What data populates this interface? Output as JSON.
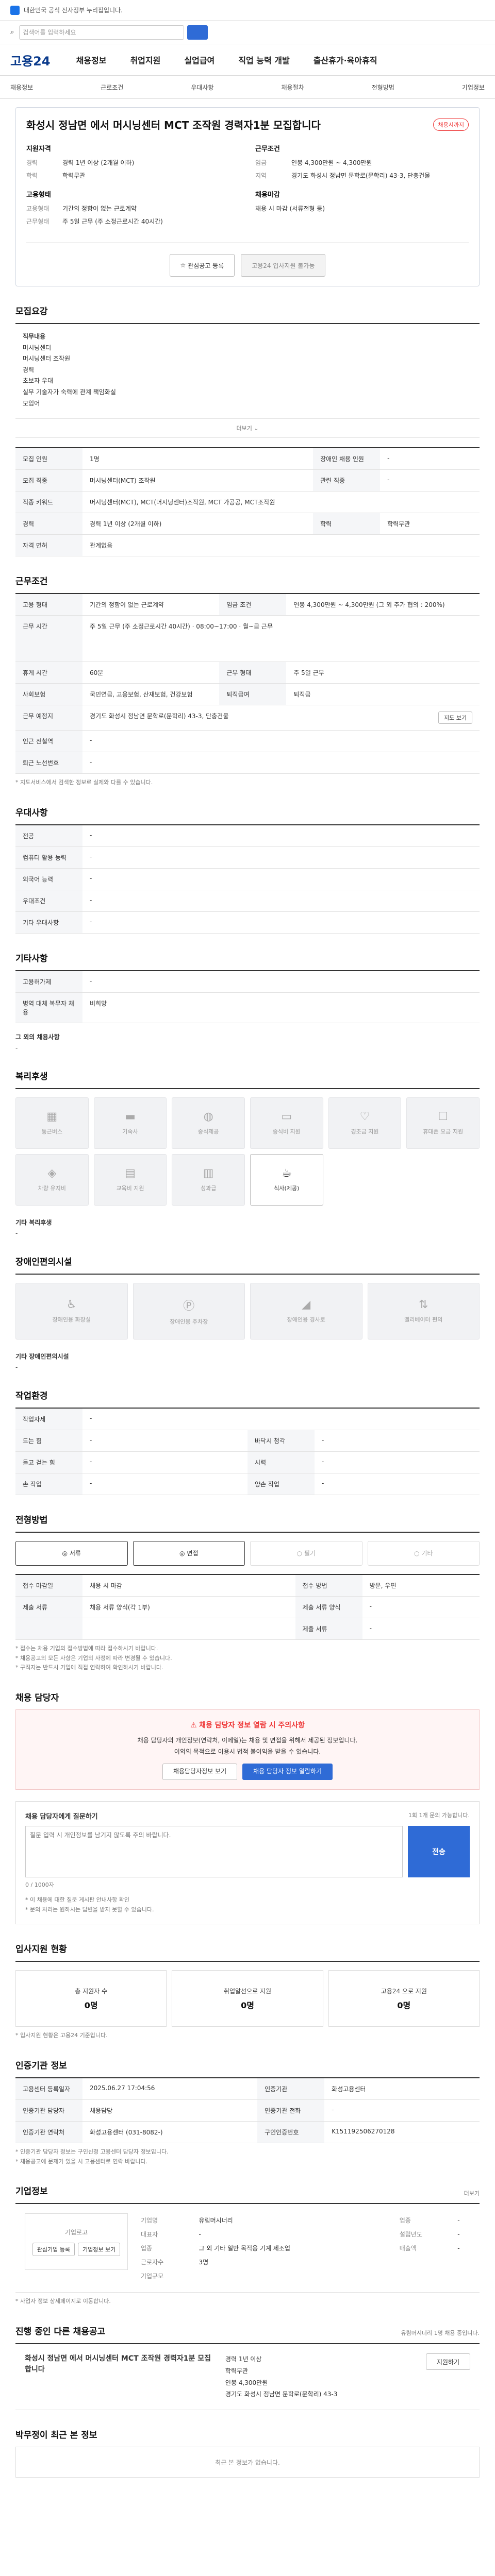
{
  "topbar": {
    "text": "대한민국 공식 전자정부 누리집입니다."
  },
  "search": {
    "placeholder": "검색어를 입력하세요"
  },
  "logo": "고용24",
  "gnb": [
    "채용정보",
    "취업지원",
    "실업급여",
    "직업 능력 개발",
    "출산휴가·육아휴직"
  ],
  "subnav": {
    "left": [
      "채용정보",
      "근로조건",
      "우대사항",
      "채용절차",
      "전형방법"
    ],
    "right": "기업정보"
  },
  "job": {
    "title": "화성시 정남면 에서 머시닝센터 MCT 조작원 경력자1분 모집합니다",
    "badge": "채용시까지",
    "left_h": "지원자격",
    "left": [
      {
        "k": "경력",
        "v": "경력 1년 이상 (2개월 이하)"
      },
      {
        "k": "학력",
        "v": "학력무관"
      }
    ],
    "left2_h": "고용형태",
    "left2": [
      {
        "k": "고용형태",
        "v": "기간의 정함이 없는 근로계약"
      },
      {
        "k": "근무형태",
        "v": "주 5일 근무 (주 소정근로시간 40시간)"
      }
    ],
    "right_h": "근무조건",
    "right": [
      {
        "k": "임금",
        "v": "연봉 4,300만원 ~ 4,300만원"
      },
      {
        "k": "지역",
        "v": "경기도 화성시 정남면 문학로(문학리) 43-3, 단충건물"
      }
    ],
    "right2_h": "채용마감",
    "right2": [
      {
        "k": "",
        "v": "채용 시 마감 (서류전형 등)"
      }
    ],
    "btn1": "관심공고 등록",
    "btn2": "고용24 입사지원 불가능"
  },
  "recruit": {
    "title": "모집요강",
    "desc_lines": [
      "직무내용",
      "머시닝센터",
      "머시닝센터 조작원",
      "경력",
      "초보자 우대",
      "실무 기술자가 숙력에 관계 책임화실",
      "모임어"
    ],
    "more": "더보기",
    "rows": [
      {
        "k": "모집 인원",
        "v": "1명",
        "k2": "장애인 채용 인원",
        "v2": "-"
      },
      {
        "k": "모집 직종",
        "v": "머시닝센터(MCT) 조작원",
        "k2": "관련 직종",
        "v2": "-"
      },
      {
        "k": "직종 키워드",
        "v": "머시닝센터(MCT), MCT(머시닝센터)조작원, MCT 가공공, MCT조작원",
        "k2": "",
        "v2": ""
      },
      {
        "k": "경력",
        "v": "경력 1년 이상 (2개월 이하)",
        "k2": "학력",
        "v2": "학력무관"
      },
      {
        "k": "자격 면허",
        "v": "관계없음",
        "k2": "",
        "v2": ""
      }
    ]
  },
  "conditions": {
    "title": "근무조건",
    "rows": [
      {
        "k": "고용 형태",
        "v": "기간의 정함이 없는 근로계약",
        "k2": "임금 조건",
        "v2": "연봉 4,300만원 ~ 4,300만원 (그 외 추가 협의 : 200%)"
      },
      {
        "k": "근무 시간",
        "v": "주 5일 근무 (주 소정근로시간 40시간) · 08:00~17:00 · 월~금 근무",
        "k2": "",
        "v2": ""
      },
      {
        "k": "휴게 시간",
        "v": "60분",
        "k2": "근무 형태",
        "v2": "주 5일 근무"
      },
      {
        "k": "사회보험",
        "v": "국민연금, 고용보험, 산재보험, 건강보험",
        "k2": "퇴직급여",
        "v2": "퇴직금"
      },
      {
        "k": "근무 예정지",
        "v": "경기도 화성시 정남면 문학로(문학리) 43-3, 단충건물",
        "k2": "",
        "v2": ""
      },
      {
        "k": "인근 전철역",
        "v": "-",
        "k2": "",
        "v2": ""
      },
      {
        "k": "퇴근 노선번호",
        "v": "-",
        "k2": "",
        "v2": ""
      }
    ],
    "map_btn": "지도 보기",
    "note": "* 지도서비스에서 검색한 정보로 실제와 다를 수 있습니다."
  },
  "pref": {
    "title": "우대사항",
    "rows": [
      {
        "k": "전공",
        "v": "-"
      },
      {
        "k": "컴퓨터 활용 능력",
        "v": "-"
      },
      {
        "k": "외국어 능력",
        "v": "-"
      },
      {
        "k": "우대조건",
        "v": "-"
      },
      {
        "k": "기타 우대사항",
        "v": "-"
      }
    ]
  },
  "etc": {
    "title": "기타사항",
    "rows": [
      {
        "k": "고용허가제",
        "v": "-"
      },
      {
        "k": "병역 대체 복무자 채용",
        "v": "비희망"
      }
    ],
    "other_h": "그 외의 채용사항",
    "other_v": "-"
  },
  "welfare": {
    "title": "복리후생",
    "tiles": [
      {
        "icon": "building-icon",
        "label": "통근버스",
        "on": false
      },
      {
        "icon": "bed-icon",
        "label": "기숙사",
        "on": false
      },
      {
        "icon": "meal-icon",
        "label": "중식제공",
        "on": false
      },
      {
        "icon": "card-icon",
        "label": "중식비 지원",
        "on": false
      },
      {
        "icon": "heart-icon",
        "label": "경조금 지원",
        "on": false
      },
      {
        "icon": "phone-icon",
        "label": "휴대폰 요금 지원",
        "on": false
      },
      {
        "icon": "car-icon",
        "label": "차량 유지비",
        "on": false
      },
      {
        "icon": "doc-icon",
        "label": "교육비 지원",
        "on": false
      },
      {
        "icon": "chart-icon",
        "label": "성과급",
        "on": false
      },
      {
        "icon": "cup-icon",
        "label": "식사(제공)",
        "on": true
      }
    ],
    "other_h": "기타 복리후생",
    "other_v": "-"
  },
  "disabled": {
    "title": "장애인편의시설",
    "tiles": [
      {
        "icon": "toilet-icon",
        "label": "장애인용 화장실"
      },
      {
        "icon": "parking-icon",
        "label": "장애인용 주차장"
      },
      {
        "icon": "ramp-icon",
        "label": "장애인용 경사로"
      },
      {
        "icon": "elevator-icon",
        "label": "엘리베이터 편의"
      }
    ],
    "other_h": "기타 장애인편의시설",
    "other_v": "-"
  },
  "env": {
    "title": "작업환경",
    "rows": [
      {
        "k": "작업자세",
        "v": "-",
        "k2": "",
        "v2": ""
      },
      {
        "k": "드는 힘",
        "v": "-",
        "k2": "바닥시 청각",
        "v2": "-"
      },
      {
        "k": "들고 걷는 힘",
        "v": "-",
        "k2": "시력",
        "v2": "-"
      },
      {
        "k": "손 작업",
        "v": "-",
        "k2": "양손 작업",
        "v2": "-"
      }
    ]
  },
  "select": {
    "title": "전형방법",
    "chips": [
      {
        "label": "서류",
        "on": true
      },
      {
        "label": "면접",
        "on": true
      },
      {
        "label": "필기",
        "on": false
      },
      {
        "label": "기타",
        "on": false
      }
    ],
    "rows": [
      {
        "k": "접수 마감일",
        "v": "채용 시 마감",
        "k2": "접수 방법",
        "v2": "방문, 우편"
      },
      {
        "k": "제출 서류",
        "v": "채용 서류 양식(각 1부)",
        "k2": "제출 서류 양식",
        "v2": "-"
      },
      {
        "k": "",
        "v": "",
        "k2": "제출 서류",
        "v2": "-"
      }
    ],
    "notes": [
      "* 접수는 채용 기업의 접수방법에 따라 접수하시기 바랍니다.",
      "* 채용공고의 모든 사항은 기업의 사정에 따라 변경될 수 있습니다.",
      "* 구직자는 반드시 기업에 직접 연락하여 확인하시기 바랍니다."
    ]
  },
  "contact": {
    "title": "채용 담당자",
    "warn_h": "채용 담당자 정보 열람 시 주의사항",
    "warn_lines": [
      "채용 담당자의 개인정보(연락처, 이메일)는 채용 및 면접을 위해서 제공된 정보입니다.",
      "이외의 목적으로 이용시 법적 불이익을 받을 수 있습니다."
    ],
    "btn1": "채용담당자정보 보기",
    "btn2": "채용 담당자 정보 열람하기",
    "ask_h": "채용 담당자에게 질문하기",
    "ask_sub": "1회 1개 문의 가능합니다.",
    "ask_ph": "질문 입력 시 개인정보를 남기지 않도록 주의 바랍니다.",
    "ask_btn": "전송",
    "count": "0 / 1000자",
    "notes": [
      "* 이 채용에 대한 질문 게시판 안내사항 확인",
      "* 문의 처리는 원하시는 답변을 받지 못할 수 있습니다."
    ]
  },
  "status": {
    "title": "입사지원 현황",
    "items": [
      {
        "label": "총 지원자 수",
        "v": "0명"
      },
      {
        "label": "취업알선으로 지원",
        "v": "0명"
      },
      {
        "label": "고용24 으로 지원",
        "v": "0명"
      }
    ],
    "note": "* 입사지원 현황은 고용24 기준입니다."
  },
  "agency": {
    "title": "인증기관 정보",
    "rows": [
      {
        "k": "고용센터 등록일자",
        "v": "2025.06.27 17:04:56",
        "k2": "인증기관",
        "v2": "화성고용센터"
      },
      {
        "k": "인증기관 담당자",
        "v": "채용담당",
        "k2": "인증기관 전화",
        "v2": "-"
      },
      {
        "k": "인증기관 연락처",
        "v": "화성고용센터 (031-8082-)",
        "k2": "구인인증번호",
        "v2": "K151192506270128"
      }
    ],
    "notes": [
      "* 인증기관 담당자 정보는 구인신청 고용센터 담당자 정보입니다.",
      "* 채용공고에 문제가 있을 시 고용센터로 연락 바랍니다."
    ]
  },
  "company": {
    "title": "기업정보",
    "more": "더보기",
    "logo_text": "기업로고",
    "logo_btn": "관심기업 등록",
    "logo_btn2": "기업정보 보기",
    "rows": [
      {
        "k": "기업명",
        "v": "유림머시너리",
        "k2": "업종",
        "v2": "-"
      },
      {
        "k": "대표자",
        "v": "-",
        "k2": "설립년도",
        "v2": "-"
      },
      {
        "k": "업종",
        "v": "그 외 기타 일반 목적용 기계 제조업",
        "k2": "매출액",
        "v2": "-"
      },
      {
        "k": "근로자수",
        "v": "3명",
        "k2": "",
        "v2": ""
      },
      {
        "k": "기업규모",
        "v": "",
        "k2": "",
        "v2": ""
      }
    ],
    "note": "* 사업자 정보 상세페이지로 이동합니다."
  },
  "recent": {
    "title": "진행 중인 다른 채용공고",
    "note": "유림머시너리 1명 채용 중입니다.",
    "card_title": "화성시 정남면 에서 머시닝센터 MCT 조작원 경력자1분 모집합니다",
    "card_meta": [
      "경력 1년 이상",
      "학력무관",
      "연봉 4,300만원",
      "경기도 화성시 정남면 문학로(문학리) 43-3"
    ],
    "btn": "지원하기"
  },
  "viewed": {
    "title": "박무정이 최근 본 정보",
    "empty": "최근 본 정보가 없습니다."
  }
}
